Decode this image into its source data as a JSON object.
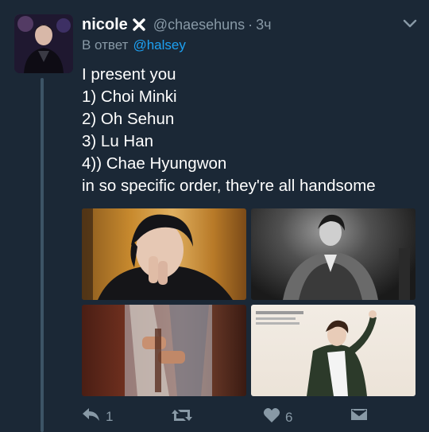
{
  "tweet": {
    "display_name": "nicole",
    "handle": "@chaesehuns",
    "separator": "·",
    "time": "3ч",
    "reply_prefix": "В ответ",
    "reply_mention": "@halsey",
    "body_lines": [
      "I present you",
      "1) Choi Minki",
      "2) Oh Sehun",
      "3) Lu Han",
      "4)) Chae Hyungwon",
      "in so specific order, they're all handsome"
    ],
    "media_count": 4
  },
  "actions": {
    "reply_count": "1",
    "retweet_count": "",
    "like_count": "6"
  },
  "icons": {
    "name_badge": "x-icon",
    "more": "chevron-down-icon",
    "reply": "reply-icon",
    "retweet": "retweet-icon",
    "like": "heart-icon",
    "dm": "envelope-icon"
  },
  "colors": {
    "background": "#1b2836",
    "secondary_text": "#8899a6",
    "link": "#1da1f2",
    "thread_line": "#3d5466"
  }
}
